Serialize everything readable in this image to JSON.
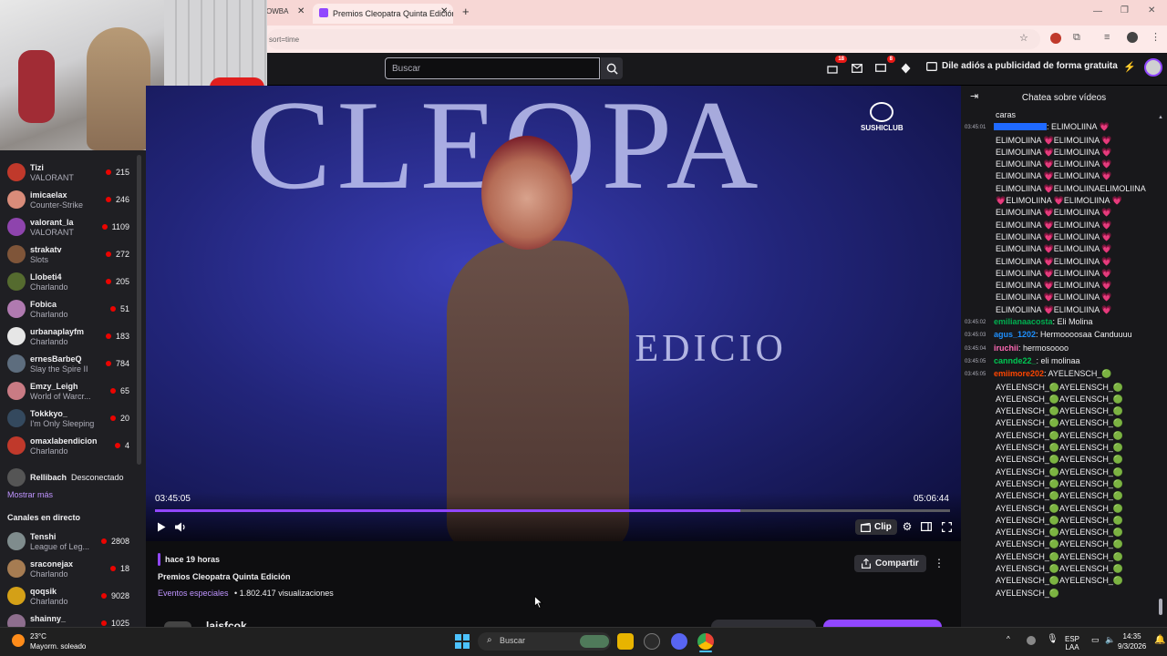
{
  "browser": {
    "prev_tab": "OWBA",
    "active_tab": "Premios Cleopatra Quinta Edición",
    "address": "sort=time"
  },
  "topnav": {
    "search_placeholder": "Buscar",
    "notif_count": "18",
    "whisper_count": "8",
    "adfree": "Dile adiós a publicidad de forma gratuita"
  },
  "sidebar": {
    "followed": [
      {
        "name": "Tizi",
        "game": "VALORANT",
        "viewers": "215",
        "color": "#c0392b"
      },
      {
        "name": "imicaelax",
        "game": "Counter-Strike",
        "viewers": "246",
        "color": "#d98c7a"
      },
      {
        "name": "valorant_la",
        "game": "VALORANT",
        "viewers": "1109",
        "color": "#8e44ad"
      },
      {
        "name": "strakatv",
        "game": "Slots",
        "viewers": "272",
        "color": "#7f5539"
      },
      {
        "name": "Llobeti4",
        "game": "Charlando",
        "viewers": "205",
        "color": "#556b2f"
      },
      {
        "name": "Fobica",
        "game": "Charlando",
        "viewers": "51",
        "color": "#b07ab0"
      },
      {
        "name": "urbanaplayfm",
        "game": "Charlando",
        "viewers": "183",
        "color": "#e6e6e6"
      },
      {
        "name": "ernesBarbeQ",
        "game": "Slay the Spire II",
        "viewers": "784",
        "color": "#5d6d7e"
      },
      {
        "name": "Emzy_Leigh",
        "game": "World of Warcr...",
        "viewers": "65",
        "color": "#c97b84"
      },
      {
        "name": "Tokkkyo_",
        "game": "I'm Only Sleeping",
        "viewers": "20",
        "color": "#34495e"
      },
      {
        "name": "omaxlabendicion",
        "game": "Charlando",
        "viewers": "4",
        "color": "#c0392b"
      }
    ],
    "offline": {
      "name": "Rellibach",
      "status": "Desconectado"
    },
    "show_more": "Mostrar más",
    "live_header": "Canales en directo",
    "live": [
      {
        "name": "Tenshi",
        "game": "League of Leg...",
        "viewers": "2808",
        "color": "#7f8c8d"
      },
      {
        "name": "sraconejax",
        "game": "Charlando",
        "viewers": "18",
        "color": "#a67c52"
      },
      {
        "name": "qoqsik",
        "game": "Charlando",
        "viewers": "9028",
        "color": "#d4a017"
      },
      {
        "name": "shainny_",
        "game": "",
        "viewers": "1025",
        "color": "#8e6e8e"
      }
    ]
  },
  "video": {
    "stage_text": "CLEOPA",
    "stage_text_2": "A EDICIO",
    "logo": "SUSHICLUB",
    "current_time": "03:45:05",
    "total_time": "05:06:44",
    "progress": 0.736,
    "clip_label": "Clip"
  },
  "info": {
    "ago": "hace 19 horas",
    "title": "Premios Cleopatra Quinta Edición",
    "category": "Eventos especiales",
    "views": " • 1.802.417 visualizaciones",
    "share": "Compartir",
    "channel": "laisfcok"
  },
  "chat": {
    "header": "Chatea sobre vídeos",
    "messages": [
      {
        "ts": "",
        "user": "",
        "color": "#efeff1",
        "text": "caras",
        "cont": true
      },
      {
        "ts": "03:45:01",
        "user": "",
        "color": "#1f69ff",
        "text": ": ELIMOLIINA 💗"
      },
      {
        "ts": "",
        "user": "",
        "color": "",
        "text": "ELIMOLIINA 💗ELIMOLIINA 💗",
        "cont": true
      },
      {
        "ts": "",
        "user": "",
        "color": "",
        "text": "ELIMOLIINA 💗ELIMOLIINA 💗",
        "cont": true
      },
      {
        "ts": "",
        "user": "",
        "color": "",
        "text": "ELIMOLIINA 💗ELIMOLIINA 💗",
        "cont": true
      },
      {
        "ts": "",
        "user": "",
        "color": "",
        "text": "ELIMOLIINA 💗ELIMOLIINA 💗",
        "cont": true
      },
      {
        "ts": "",
        "user": "",
        "color": "",
        "text": "ELIMOLIINA 💗ELIMOLIINAELIMOLIINA",
        "cont": true
      },
      {
        "ts": "",
        "user": "",
        "color": "",
        "text": "💗ELIMOLIINA 💗ELIMOLIINA 💗",
        "cont": true
      },
      {
        "ts": "",
        "user": "",
        "color": "",
        "text": "ELIMOLIINA 💗ELIMOLIINA 💗",
        "cont": true
      },
      {
        "ts": "",
        "user": "",
        "color": "",
        "text": "ELIMOLIINA 💗ELIMOLIINA 💗",
        "cont": true
      },
      {
        "ts": "",
        "user": "",
        "color": "",
        "text": "ELIMOLIINA 💗ELIMOLIINA 💗",
        "cont": true
      },
      {
        "ts": "",
        "user": "",
        "color": "",
        "text": "ELIMOLIINA 💗ELIMOLIINA 💗",
        "cont": true
      },
      {
        "ts": "",
        "user": "",
        "color": "",
        "text": "ELIMOLIINA 💗ELIMOLIINA 💗",
        "cont": true
      },
      {
        "ts": "",
        "user": "",
        "color": "",
        "text": "ELIMOLIINA 💗ELIMOLIINA 💗",
        "cont": true
      },
      {
        "ts": "",
        "user": "",
        "color": "",
        "text": "ELIMOLIINA 💗ELIMOLIINA 💗",
        "cont": true
      },
      {
        "ts": "",
        "user": "",
        "color": "",
        "text": "ELIMOLIINA 💗ELIMOLIINA 💗",
        "cont": true
      },
      {
        "ts": "",
        "user": "",
        "color": "",
        "text": "ELIMOLIINA 💗ELIMOLIINA 💗",
        "cont": true
      },
      {
        "ts": "03:45:02",
        "user": "emilianaacosta",
        "color": "#00b050",
        "text": ": Eli Molina"
      },
      {
        "ts": "03:45:03",
        "user": "agus_1202",
        "color": "#1e90ff",
        "text": ": Hermoooosaa Canduuuu"
      },
      {
        "ts": "03:45:04",
        "user": "iruchii",
        "color": "#ff69b4",
        "text": ": hermosoooo"
      },
      {
        "ts": "03:45:05",
        "user": "cannde22_",
        "color": "#00c853",
        "text": ": eli molinaa"
      },
      {
        "ts": "03:45:05",
        "user": "emiimore202",
        "color": "#ff4500",
        "text": ": AYELENSCH_🟢"
      },
      {
        "ts": "",
        "user": "",
        "color": "",
        "text": "AYELENSCH_🟢AYELENSCH_🟢",
        "cont": true
      },
      {
        "ts": "",
        "user": "",
        "color": "",
        "text": "AYELENSCH_🟢AYELENSCH_🟢",
        "cont": true
      },
      {
        "ts": "",
        "user": "",
        "color": "",
        "text": "AYELENSCH_🟢AYELENSCH_🟢",
        "cont": true
      },
      {
        "ts": "",
        "user": "",
        "color": "",
        "text": "AYELENSCH_🟢AYELENSCH_🟢",
        "cont": true
      },
      {
        "ts": "",
        "user": "",
        "color": "",
        "text": "AYELENSCH_🟢AYELENSCH_🟢",
        "cont": true
      },
      {
        "ts": "",
        "user": "",
        "color": "",
        "text": "AYELENSCH_🟢AYELENSCH_🟢",
        "cont": true
      },
      {
        "ts": "",
        "user": "",
        "color": "",
        "text": "AYELENSCH_🟢AYELENSCH_🟢",
        "cont": true
      },
      {
        "ts": "",
        "user": "",
        "color": "",
        "text": "AYELENSCH_🟢AYELENSCH_🟢",
        "cont": true
      },
      {
        "ts": "",
        "user": "",
        "color": "",
        "text": "AYELENSCH_🟢AYELENSCH_🟢",
        "cont": true
      },
      {
        "ts": "",
        "user": "",
        "color": "",
        "text": "AYELENSCH_🟢AYELENSCH_🟢",
        "cont": true
      },
      {
        "ts": "",
        "user": "",
        "color": "",
        "text": "AYELENSCH_🟢AYELENSCH_🟢",
        "cont": true
      },
      {
        "ts": "",
        "user": "",
        "color": "",
        "text": "AYELENSCH_🟢AYELENSCH_🟢",
        "cont": true
      },
      {
        "ts": "",
        "user": "",
        "color": "",
        "text": "AYELENSCH_🟢AYELENSCH_🟢",
        "cont": true
      },
      {
        "ts": "",
        "user": "",
        "color": "",
        "text": "AYELENSCH_🟢AYELENSCH_🟢",
        "cont": true
      },
      {
        "ts": "",
        "user": "",
        "color": "",
        "text": "AYELENSCH_🟢AYELENSCH_🟢",
        "cont": true
      },
      {
        "ts": "",
        "user": "",
        "color": "",
        "text": "AYELENSCH_🟢AYELENSCH_🟢",
        "cont": true
      },
      {
        "ts": "",
        "user": "",
        "color": "",
        "text": "AYELENSCH_🟢AYELENSCH_🟢",
        "cont": true
      },
      {
        "ts": "",
        "user": "",
        "color": "",
        "text": "AYELENSCH_🟢",
        "cont": true
      }
    ]
  },
  "taskbar": {
    "temp": "23°C",
    "weather": "Mayorm. soleado",
    "search": "Buscar",
    "lang": "ESP",
    "region": "LAA",
    "time": "14:35",
    "date": "9/3/2026"
  },
  "colors": {
    "accent": "#9147ff",
    "live": "#eb0400"
  }
}
